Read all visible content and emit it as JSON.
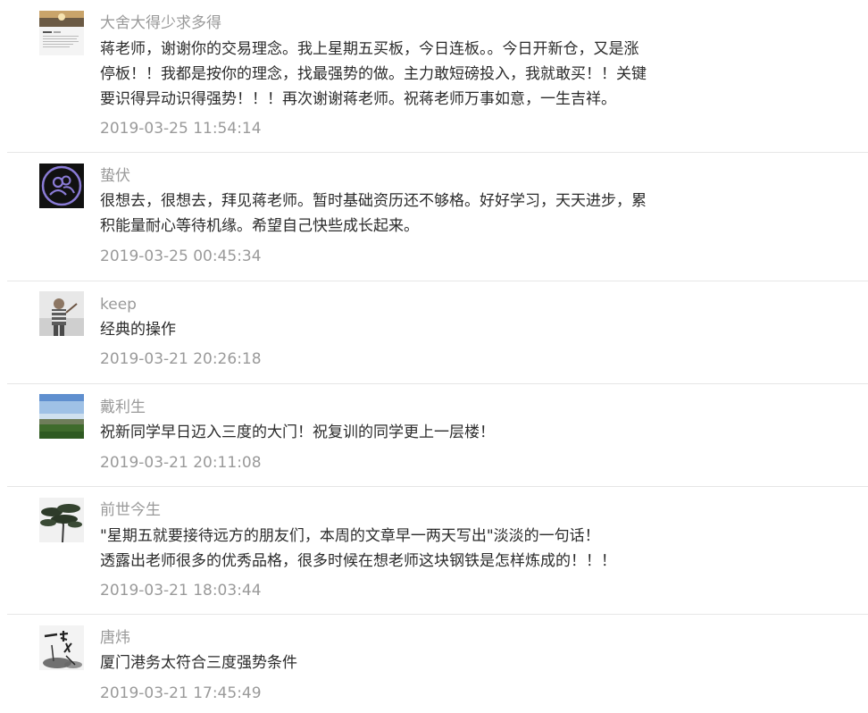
{
  "comments": [
    {
      "author": "大舍大得少求多得",
      "lines": [
        "蒋老师，谢谢你的交易理念。我上星期五买板，今日连板。。今日开新仓，又是涨",
        "停板！！我都是按你的理念，找最强势的做。主力敢短磅投入，我就敢买！！关键",
        "要识得异动识得强势！！！再次谢谢蒋老师。祝蒋老师万事如意，一生吉祥。"
      ],
      "time": "2019-03-25 11:54:14",
      "avatar": "landscape-with-text-avatar"
    },
    {
      "author": "蛰伏",
      "lines": [
        "很想去，很想去，拜见蒋老师。暂时基础资历还不够格。好好学习，天天进步，累",
        "积能量耐心等待机缘。希望自己快些成长起来。"
      ],
      "time": "2019-03-25 00:45:34",
      "avatar": "default-user-avatar"
    },
    {
      "author": "keep",
      "lines": [
        "经典的操作"
      ],
      "time": "2019-03-21 20:26:18",
      "avatar": "person-photo-avatar"
    },
    {
      "author": "戴利生",
      "lines": [
        "祝新同学早日迈入三度的大门！祝复训的同学更上一层楼！"
      ],
      "time": "2019-03-21 20:11:08",
      "avatar": "sky-landscape-avatar"
    },
    {
      "author": "前世今生",
      "lines": [
        "\"星期五就要接待远方的朋友们，本周的文章早一两天写出\"淡淡的一句话！",
        "透露出老师很多的优秀品格，很多时候在想老师这块钢铁是怎样炼成的！！！"
      ],
      "time": "2019-03-21 18:03:44",
      "avatar": "pine-tree-avatar"
    },
    {
      "author": "唐炜",
      "lines": [
        "厦门港务太符合三度强势条件"
      ],
      "time": "2019-03-21 17:45:49",
      "avatar": "calligraphy-sword-avatar"
    }
  ]
}
